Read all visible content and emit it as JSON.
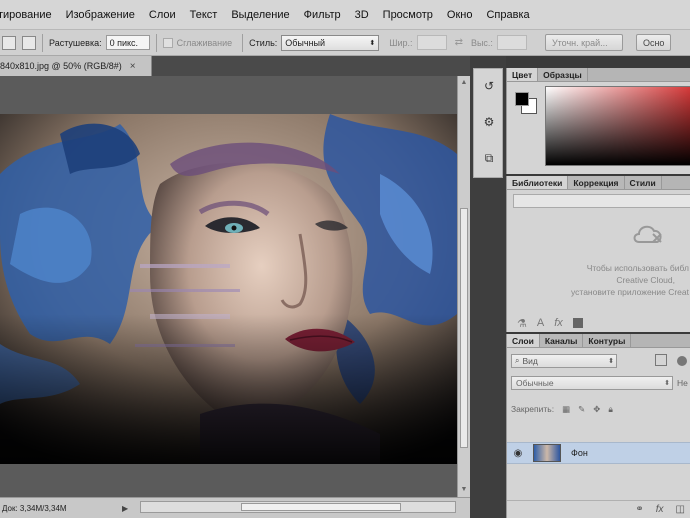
{
  "menu": {
    "items": [
      "тирование",
      "Изображение",
      "Слои",
      "Текст",
      "Выделение",
      "Фильтр",
      "3D",
      "Просмотр",
      "Окно",
      "Справка"
    ]
  },
  "options": {
    "feather_label": "Растушевка:",
    "feather_value": "0 пикс.",
    "antialias_label": "Сглаживание",
    "style_label": "Стиль:",
    "style_value": "Обычный",
    "width_label": "Шир.:",
    "height_label": "Выс.:",
    "refine_button": "Уточн. край...",
    "truncated_button": "Ocнo"
  },
  "document": {
    "tab_title": "840x810.jpg @ 50% (RGB/8#)",
    "close_glyph": "×",
    "status": "Док: 3,34M/3,34M"
  },
  "color_panel": {
    "tabs": [
      "Цвет",
      "Образцы"
    ],
    "foreground": "#000000",
    "background": "#ffffff",
    "picker_hue": "#d63a3a"
  },
  "libraries_panel": {
    "tabs": [
      "Библиотеки",
      "Коррекция",
      "Стили"
    ],
    "message_lines": [
      "Чтобы использовать библ",
      "Creative Cloud,",
      "установите приложение Creat"
    ]
  },
  "layers_panel": {
    "tabs": [
      "Слои",
      "Каналы",
      "Контуры"
    ],
    "filter_label": "Вид",
    "blend_mode": "Обычные",
    "opacity_label": "Не",
    "lock_label": "Закрепить:",
    "layer_name": "Фон"
  },
  "colors": {
    "ui_light": "#d4d4d4",
    "dark_bg": "#535353",
    "selection": "#bfd0e6"
  }
}
